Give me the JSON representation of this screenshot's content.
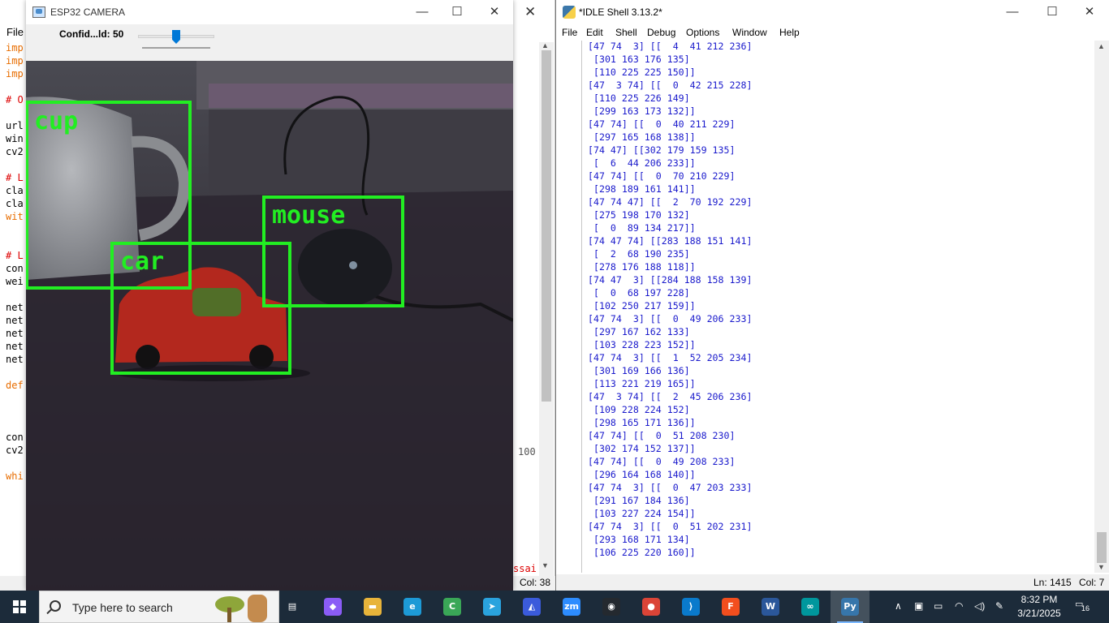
{
  "editor": {
    "menu_file": "File",
    "code_lines": [
      {
        "text": "imp",
        "cls": "kw"
      },
      {
        "text": "imp",
        "cls": "kw"
      },
      {
        "text": "imp",
        "cls": "kw"
      },
      {
        "text": "",
        "cls": "nm"
      },
      {
        "text": "# O",
        "cls": "cm"
      },
      {
        "text": "",
        "cls": "nm"
      },
      {
        "text": "url",
        "cls": "nm"
      },
      {
        "text": "win",
        "cls": "nm"
      },
      {
        "text": "cv2",
        "cls": "nm"
      },
      {
        "text": "",
        "cls": "nm"
      },
      {
        "text": "# L",
        "cls": "cm"
      },
      {
        "text": "cla",
        "cls": "nm"
      },
      {
        "text": "cla",
        "cls": "nm"
      },
      {
        "text": "wit",
        "cls": "kw"
      },
      {
        "text": "",
        "cls": "nm"
      },
      {
        "text": "",
        "cls": "nm"
      },
      {
        "text": "# L",
        "cls": "cm"
      },
      {
        "text": "con",
        "cls": "nm"
      },
      {
        "text": "wei",
        "cls": "nm"
      },
      {
        "text": "",
        "cls": "nm"
      },
      {
        "text": "net",
        "cls": "nm"
      },
      {
        "text": "net",
        "cls": "nm"
      },
      {
        "text": "net",
        "cls": "nm"
      },
      {
        "text": "net",
        "cls": "nm"
      },
      {
        "text": "net",
        "cls": "nm"
      },
      {
        "text": "",
        "cls": "nm"
      },
      {
        "text": "def",
        "cls": "kw"
      },
      {
        "text": "",
        "cls": "nm"
      },
      {
        "text": "",
        "cls": "nm"
      },
      {
        "text": "",
        "cls": "nm"
      },
      {
        "text": "con",
        "cls": "nm"
      },
      {
        "text": "cv2",
        "cls": "nm"
      },
      {
        "text": "",
        "cls": "nm"
      },
      {
        "text": "whi",
        "cls": "kw"
      }
    ],
    "gutter_number": "100",
    "bottom_fragment": "ssai",
    "status_col": "Col: 38"
  },
  "camera": {
    "title": "ESP32 CAMERA",
    "trackbar_label": "Confid...ld: 50",
    "trackbar_value": 50,
    "detections": [
      {
        "label": "cup"
      },
      {
        "label": "mouse"
      },
      {
        "label": "car"
      }
    ],
    "box_color": "#22ee22"
  },
  "shell": {
    "title": "*IDLE Shell 3.13.2*",
    "menu": [
      "File",
      "Edit",
      "Shell",
      "Debug",
      "Options",
      "Window",
      "Help"
    ],
    "lines": [
      "[47 74  3] [[  4  41 212 236]",
      " [301 163 176 135]",
      " [110 225 225 150]]",
      "[47  3 74] [[  0  42 215 228]",
      " [110 225 226 149]",
      " [299 163 173 132]]",
      "[47 74] [[  0  40 211 229]",
      " [297 165 168 138]]",
      "[74 47] [[302 179 159 135]",
      " [  6  44 206 233]]",
      "[47 74] [[  0  70 210 229]",
      " [298 189 161 141]]",
      "[47 74 47] [[  2  70 192 229]",
      " [275 198 170 132]",
      " [  0  89 134 217]]",
      "[74 47 74] [[283 188 151 141]",
      " [  2  68 190 235]",
      " [278 176 188 118]]",
      "[74 47  3] [[284 188 158 139]",
      " [  0  68 197 228]",
      " [102 250 217 159]]",
      "[47 74  3] [[  0  49 206 233]",
      " [297 167 162 133]",
      " [103 228 223 152]]",
      "[47 74  3] [[  1  52 205 234]",
      " [301 169 166 136]",
      " [113 221 219 165]]",
      "[47  3 74] [[  2  45 206 236]",
      " [109 228 224 152]",
      " [298 165 171 136]]",
      "[47 74] [[  0  51 208 230]",
      " [302 174 152 137]]",
      "[47 74] [[  0  49 208 233]",
      " [296 164 168 140]]",
      "[47 74  3] [[  0  47 203 233]",
      " [291 167 184 136]",
      " [103 227 224 154]]",
      "[47 74  3] [[  0  51 202 231]",
      " [293 168 171 134]",
      " [106 225 220 160]]"
    ],
    "status_ln": "Ln: 1415",
    "status_col": "Col: 7"
  },
  "taskbar": {
    "search_placeholder": "Type here to search",
    "apps": [
      {
        "name": "task-view-icon",
        "glyph": "▤",
        "color": "transparent"
      },
      {
        "name": "copilot-icon",
        "glyph": "◆",
        "color": "#8a5cf6"
      },
      {
        "name": "file-explorer-icon",
        "glyph": "▬",
        "color": "#e8b43a"
      },
      {
        "name": "edge-icon",
        "glyph": "e",
        "color": "#1d9ad6"
      },
      {
        "name": "chrome-profile-icon",
        "glyph": "C",
        "color": "#3aa757"
      },
      {
        "name": "telegram-icon",
        "glyph": "➤",
        "color": "#2aa3de"
      },
      {
        "name": "blue-app-icon",
        "glyph": "◭",
        "color": "#3b5bdb"
      },
      {
        "name": "zoom-icon",
        "glyph": "zm",
        "color": "#2d8cff"
      },
      {
        "name": "github-icon",
        "glyph": "◉",
        "color": "#24292f"
      },
      {
        "name": "chrome-icon",
        "glyph": "●",
        "color": "#db4437"
      },
      {
        "name": "vscode-icon",
        "glyph": "⟩",
        "color": "#0a7acc"
      },
      {
        "name": "figma-icon",
        "glyph": "F",
        "color": "#f24e1e"
      },
      {
        "name": "word-icon",
        "glyph": "W",
        "color": "#2b579a"
      },
      {
        "name": "arduino-icon",
        "glyph": "∞",
        "color": "#00979d"
      },
      {
        "name": "idle-python-icon",
        "glyph": "Py",
        "color": "#3776ab"
      }
    ],
    "time": "8:32 PM",
    "date": "3/21/2025",
    "notification_count": "16"
  }
}
